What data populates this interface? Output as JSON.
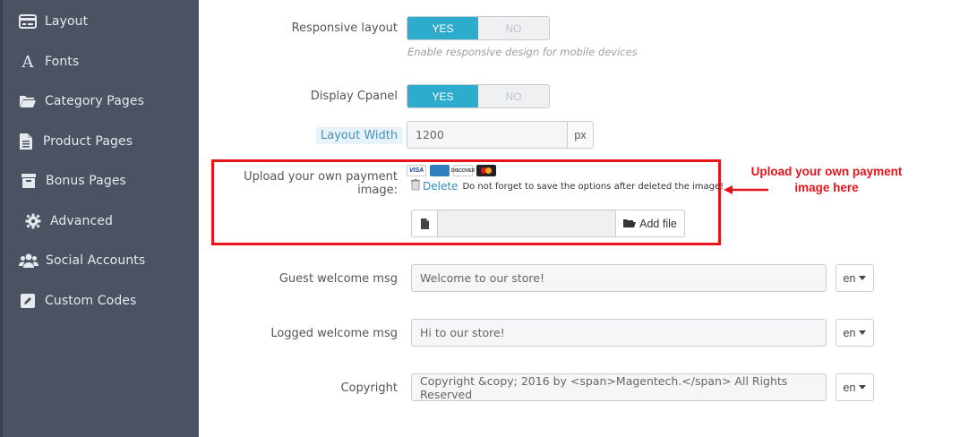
{
  "sidebar": {
    "items": [
      {
        "label": "Layout",
        "icon": "layout-icon"
      },
      {
        "label": "Fonts",
        "icon": "font-icon"
      },
      {
        "label": "Category Pages",
        "icon": "folder-open-icon"
      },
      {
        "label": "Product Pages",
        "icon": "file-icon"
      },
      {
        "label": "Bonus Pages",
        "icon": "archive-icon"
      },
      {
        "label": "Advanced",
        "icon": "gear-icon"
      },
      {
        "label": "Social Accounts",
        "icon": "users-icon"
      },
      {
        "label": "Custom Codes",
        "icon": "edit-icon"
      }
    ]
  },
  "form": {
    "responsive": {
      "label": "Responsive layout",
      "yes": "YES",
      "no": "NO",
      "help": "Enable responsive design for mobile devices"
    },
    "cpanel": {
      "label": "Display Cpanel",
      "yes": "YES",
      "no": "NO"
    },
    "layout_width": {
      "label": "Layout Width",
      "value": "1200",
      "unit": "px"
    },
    "payment": {
      "label": "Upload your own payment image:",
      "cards": [
        "VISA",
        "AMEX",
        "DISCOVER",
        "MC"
      ],
      "delete_label": "Delete",
      "delete_note": "Do not forget to save the options after deleted the image!",
      "add_file_label": "Add file"
    },
    "guest_msg": {
      "label": "Guest welcome msg",
      "value": "Welcome to our store!",
      "lang": "en"
    },
    "logged_msg": {
      "label": "Logged welcome msg",
      "value": "Hi to our store!",
      "lang": "en"
    },
    "copyright": {
      "label": "Copyright",
      "value": "Copyright &copy; 2016 by <span>Magentech.</span> All Rights Reserved",
      "lang": "en"
    }
  },
  "annotation": {
    "line1": "Upload your own payment",
    "line2": "image here"
  },
  "colors": {
    "sidebar_bg": "#4b5362",
    "accent": "#2eacce",
    "annotation_red": "#e8141b"
  }
}
